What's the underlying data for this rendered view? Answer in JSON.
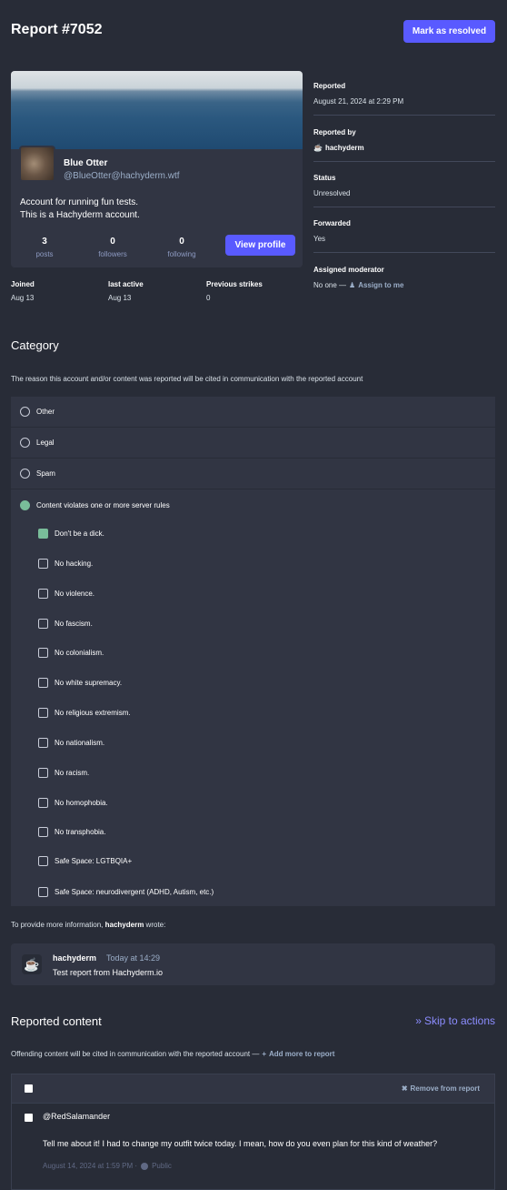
{
  "header": {
    "title": "Report #7052",
    "resolve_label": "Mark as resolved"
  },
  "account": {
    "display_name": "Blue Otter",
    "acct": "@BlueOtter@hachyderm.wtf",
    "bio_line1": "Account for running fun tests.",
    "bio_line2": "This is a Hachyderm account.",
    "stats": [
      {
        "value": "3",
        "label": "posts"
      },
      {
        "value": "0",
        "label": "followers"
      },
      {
        "value": "0",
        "label": "following"
      }
    ],
    "view_profile_label": "View profile",
    "meta": [
      {
        "label": "Joined",
        "value": "Aug 13"
      },
      {
        "label": "last active",
        "value": "Aug 13"
      },
      {
        "label": "Previous strikes",
        "value": "0"
      }
    ]
  },
  "sidebar": {
    "reported_label": "Reported",
    "reported_value": "August 21, 2024 at 2:29 PM",
    "reported_by_label": "Reported by",
    "reported_by_value": "hachyderm",
    "status_label": "Status",
    "status_value": "Unresolved",
    "forwarded_label": "Forwarded",
    "forwarded_value": "Yes",
    "moderator_label": "Assigned moderator",
    "moderator_value": "No one —",
    "assign_label": "Assign to me"
  },
  "category": {
    "heading": "Category",
    "hint": "The reason this account and/or content was reported will be cited in communication with the reported account",
    "options": [
      {
        "label": "Other",
        "selected": false
      },
      {
        "label": "Legal",
        "selected": false
      },
      {
        "label": "Spam",
        "selected": false
      },
      {
        "label": "Content violates one or more server rules",
        "selected": true
      }
    ],
    "rules": [
      {
        "label": "Don't be a dick.",
        "checked": true
      },
      {
        "label": "No hacking.",
        "checked": false
      },
      {
        "label": "No violence.",
        "checked": false
      },
      {
        "label": "No fascism.",
        "checked": false
      },
      {
        "label": "No colonialism.",
        "checked": false
      },
      {
        "label": "No white supremacy.",
        "checked": false
      },
      {
        "label": "No religious extremism.",
        "checked": false
      },
      {
        "label": "No nationalism.",
        "checked": false
      },
      {
        "label": "No racism.",
        "checked": false
      },
      {
        "label": "No homophobia.",
        "checked": false
      },
      {
        "label": "No transphobia.",
        "checked": false
      },
      {
        "label": "Safe Space: LGTBQIA+",
        "checked": false
      },
      {
        "label": "Safe Space: neurodivergent (ADHD, Autism, etc.)",
        "checked": false
      }
    ]
  },
  "comment": {
    "intro_prefix": "To provide more information,",
    "intro_user": "hachyderm",
    "intro_suffix": "wrote:",
    "author": "hachyderm",
    "time": "Today at 14:29",
    "text": "Test report from Hachyderm.io"
  },
  "reported_content": {
    "heading": "Reported content",
    "skip_label": "Skip to actions",
    "hint": "Offending content will be cited in communication with the reported account —",
    "add_label": "Add more to report",
    "remove_label": "Remove from report",
    "status": {
      "account": "@RedSalamander",
      "text": "Tell me about it! I had to change my outfit twice today. I mean, how do you even plan for this kind of weather?",
      "date": "August 14, 2024 at 1:59 PM ·",
      "visibility": "Public"
    }
  },
  "colors": {
    "accent": "#595aff",
    "selected": "#79bd9a",
    "link": "#8c8dff"
  }
}
